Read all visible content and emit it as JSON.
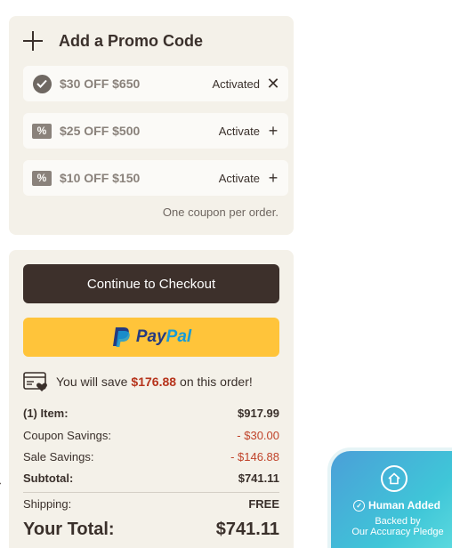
{
  "promo": {
    "title": "Add a Promo Code",
    "coupons": [
      {
        "code": "$30 OFF $650",
        "status": "Activated",
        "action": "✕",
        "icon": "check-circle-icon"
      },
      {
        "code": "$25 OFF $500",
        "status": "Activate",
        "action": "+",
        "icon": "coupon-ticket-icon"
      },
      {
        "code": "$10 OFF $150",
        "status": "Activate",
        "action": "+",
        "icon": "coupon-ticket-icon"
      }
    ],
    "note": "One coupon per order."
  },
  "summary": {
    "checkout_label": "Continue to Checkout",
    "paypal": {
      "pay": "Pay",
      "pal": "Pal"
    },
    "savings": {
      "prefix": "You will save",
      "amount": "$176.88",
      "suffix": "on this order!"
    },
    "rows": [
      {
        "label": "(1) Item:",
        "value": "$917.99"
      },
      {
        "label": "Coupon Savings:",
        "value": "- $30.00"
      },
      {
        "label": "Sale Savings:",
        "value": "- $146.88"
      },
      {
        "label": "Subtotal:",
        "value": "$741.11"
      },
      {
        "label": "Shipping:",
        "value": "FREE"
      }
    ],
    "total": {
      "label": "Your Total:",
      "value": "$741.11"
    }
  },
  "badge": {
    "title": "Human Added",
    "line1": "Backed by",
    "line2": "Our Accuracy Pledge"
  },
  "colors": {
    "card_bg": "#f4f1e9",
    "checkout_bg": "#3d302b",
    "paypal_bg": "#ffc43a",
    "savings_red": "#b6341c"
  }
}
